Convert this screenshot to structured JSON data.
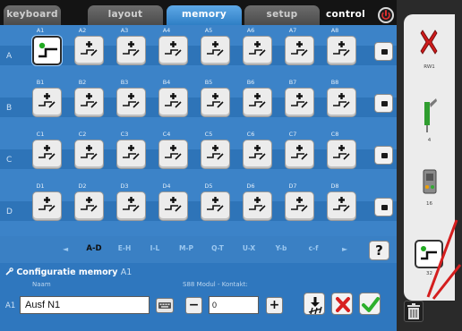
{
  "tabs": [
    {
      "label": "keyboard",
      "active": false
    },
    {
      "label": "layout",
      "active": false
    },
    {
      "label": "memory",
      "active": true
    },
    {
      "label": "setup",
      "active": false
    },
    {
      "label": "control",
      "active": false
    }
  ],
  "power_icon": "power-icon",
  "grid": {
    "rows": [
      {
        "letter": "A",
        "cols": [
          "A1",
          "A2",
          "A3",
          "A4",
          "A5",
          "A6",
          "A7",
          "A8"
        ]
      },
      {
        "letter": "B",
        "cols": [
          "B1",
          "B2",
          "B3",
          "B4",
          "B5",
          "B6",
          "B7",
          "B8"
        ]
      },
      {
        "letter": "C",
        "cols": [
          "C1",
          "C2",
          "C3",
          "C4",
          "C5",
          "C6",
          "C7",
          "C8"
        ]
      },
      {
        "letter": "D",
        "cols": [
          "D1",
          "D2",
          "D3",
          "D4",
          "D5",
          "D6",
          "D7",
          "D8"
        ]
      }
    ],
    "selected_cell": "A1",
    "cell_icon": "route-icon",
    "selected_icon": "route-selected-icon"
  },
  "page_nav": {
    "prev": "◄",
    "pages": [
      "A-D",
      "E-H",
      "I-L",
      "M-P",
      "Q-T",
      "U-X",
      "Y-b",
      "c-f"
    ],
    "active_page": "A-D",
    "next": "►",
    "help": "?"
  },
  "config": {
    "title_prefix": "Co",
    "title_main": "nfiguratie memory",
    "title_address": "A1",
    "name_label": "Naam",
    "contact_label": "S88 Modul - Kontakt:",
    "address": "A1",
    "name_value": "Ausf N1",
    "contact_value": "0",
    "minus": "−",
    "plus": "+"
  },
  "sidebar": {
    "items": [
      {
        "label": "RW1",
        "icon": "double-slip-icon"
      },
      {
        "label": "4",
        "icon": "signal-icon"
      },
      {
        "label": "16",
        "icon": "s88-contact-icon"
      },
      {
        "label": "32",
        "icon": "memory-route-icon"
      }
    ]
  },
  "colors": {
    "panel_blue": "#3c83c8",
    "tab_active": "#2f7fc5",
    "accept_green": "#2db02d",
    "cancel_red": "#d81f1f",
    "status_green": "#22aa22"
  }
}
